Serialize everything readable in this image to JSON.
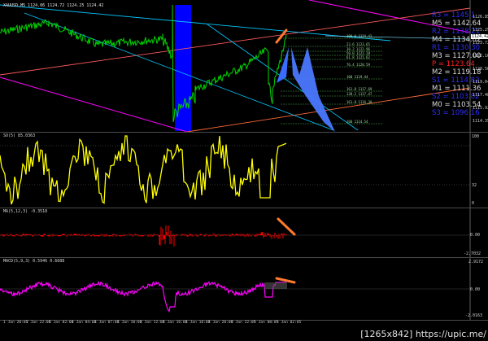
{
  "chart_header": {
    "symbol_line": "XAUUSD,M5  1124.06 1124.72 1124.25 1124.42"
  },
  "price_axis": [
    "1126.85",
    "1125.29",
    "1123.72",
    "1122.16",
    "1120.56",
    "1119.04",
    "1117.48",
    "1115.92",
    "1114.35"
  ],
  "current_price": "1124.42",
  "pivots": [
    {
      "label": "R3",
      "value": "1145.1",
      "color": "#2d2dff"
    },
    {
      "label": "M5",
      "value": "1142.64",
      "color": "#dcdcdc"
    },
    {
      "label": "R2",
      "value": "1138.21",
      "color": "#2d2dff"
    },
    {
      "label": "M4",
      "value": "1134.82",
      "color": "#dcdcdc"
    },
    {
      "label": "R1",
      "value": "1130.30",
      "color": "#2d2dff"
    },
    {
      "label": "M3",
      "value": "1127.00",
      "color": "#dcdcdc"
    },
    {
      "label": "P",
      "value": "1123.64",
      "color": "#ff2020"
    },
    {
      "label": "M2",
      "value": "1119.18",
      "color": "#dcdcdc"
    },
    {
      "label": "S1",
      "value": "1114.82",
      "color": "#2d2dff"
    },
    {
      "label": "M1",
      "value": "1111.36",
      "color": "#dcdcdc"
    },
    {
      "label": "S2",
      "value": "1103.82",
      "color": "#2d2dff"
    },
    {
      "label": "M0",
      "value": "1103.54",
      "color": "#dcdcdc"
    },
    {
      "label": "S3",
      "value": "1096.16",
      "color": "#2d2dff"
    }
  ],
  "fib_labels": [
    "100.0 1124.42",
    "23.6 1123.65",
    "38.2 1122.96",
    "50.0 1122.28",
    "61.8 1121.62",
    "76.4 1120.59",
    "100 1119.44",
    "161.8 1117.69",
    "138.2 1117.47",
    "161.8 1116.30",
    "200 1114.54"
  ],
  "indicators": [
    {
      "label": "SO(5) 85.0363",
      "top": "100",
      "bottom": "0",
      "mid": "32"
    },
    {
      "label": "MA(5,12,3) -0.3518",
      "top": "",
      "bottom": "-2.7032",
      "mid": "0.00"
    },
    {
      "label": "MACD(5,9,3) 0.5946 0.6688",
      "top": "2.9172",
      "bottom": "-2.0163",
      "mid": "0.00"
    }
  ],
  "x_axis_labels": [
    "1 Jan 20:05",
    "2 Jan 22:05",
    "4 Jan 02:05",
    "4 Jan 04:05",
    "4 Jan 07:05",
    "4 Jan 10:05",
    "4 Jan 12:05",
    "4 Jan 16:05",
    "4 Jan 18:05",
    "4 Jan 20:05",
    "4 Jan 22:05",
    "5 Jan 00:05",
    "5 Jan 02:05"
  ],
  "watermark": "[1265x842] https://upic.me/",
  "colors": {
    "price": "#00d400",
    "blue_band": "#0000ff",
    "yellow": "#ffff00",
    "red": "#ff0000",
    "magenta": "#ff00ff",
    "orange": "#ff7a2e",
    "channel": "#00c8ff",
    "pink": "#ff00ff",
    "salmon": "#ff6040"
  }
}
